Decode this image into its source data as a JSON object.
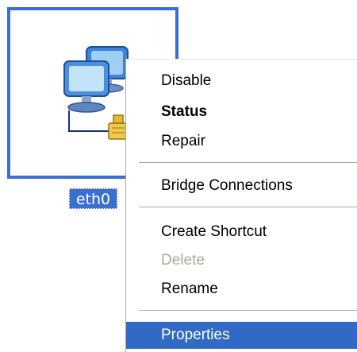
{
  "connection": {
    "label": "eth0"
  },
  "context_menu": {
    "items": [
      {
        "label": "Disable"
      },
      {
        "label": "Status"
      },
      {
        "label": "Repair"
      },
      {
        "label": "Bridge Connections"
      },
      {
        "label": "Create Shortcut"
      },
      {
        "label": "Delete"
      },
      {
        "label": "Rename"
      },
      {
        "label": "Properties"
      }
    ],
    "default_item": "Status",
    "disabled_items": [
      "Delete"
    ],
    "highlighted_item": "Properties"
  },
  "colors": {
    "selection": "#316ac5",
    "icon_border": "#3a6fd0",
    "disabled_text": "#aca899"
  },
  "icons": {
    "connection": "network-connection-icon",
    "plug": "network-plug-icon"
  }
}
